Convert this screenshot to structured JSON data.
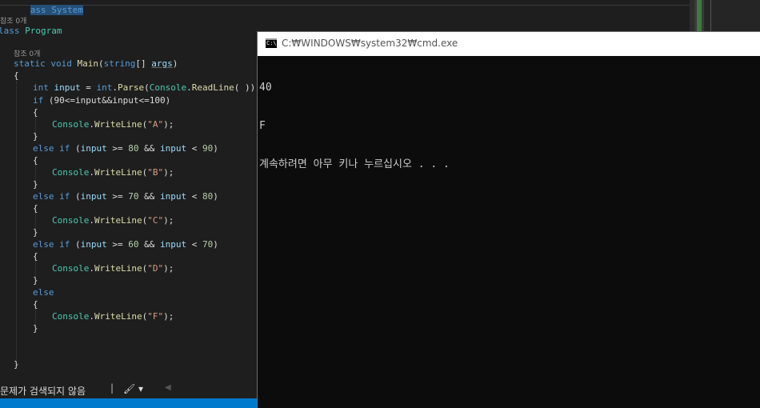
{
  "editor": {
    "header_fragment": "ass System",
    "refs": [
      "참조 0개",
      "참조 0개"
    ],
    "class_decl": {
      "kw": "lass",
      "name": "Program"
    },
    "main_decl": {
      "static": "static",
      "void": "void",
      "name": "Main",
      "paren_open": "(",
      "string": "string",
      "brackets": "[]",
      "args": "args",
      "paren_close": ")"
    },
    "open_brace": "{",
    "close_brace": "}",
    "input_line": {
      "int": "int",
      "var": "input",
      "eq": " = ",
      "int2": "int",
      "dot": ".",
      "parse": "Parse",
      "po": "(",
      "console": "Console",
      "dot2": ".",
      "readline": "ReadLine",
      "end": "( ));"
    },
    "if_line": {
      "kw": "if",
      "rest": " (90<=input&&input<=100)"
    },
    "else_if_1": {
      "else": "else",
      "if": "if",
      "open": " (",
      "var": "input",
      "op1": " >= ",
      "n1": "80",
      "and": " && ",
      "var2": "input",
      "op2": " < ",
      "n2": "90",
      "close": ")"
    },
    "else_if_2": {
      "else": "else",
      "if": "if",
      "open": " (",
      "var": "input",
      "op1": " >= ",
      "n1": "70",
      "and": " && ",
      "var2": "input",
      "op2": " < ",
      "n2": "80",
      "close": ")"
    },
    "else_if_3": {
      "else": "else",
      "if": "if",
      "open": " (",
      "var": "input",
      "op1": " >= ",
      "n1": "60",
      "and": " && ",
      "var2": "input",
      "op2": " < ",
      "n2": "70",
      "close": ")"
    },
    "else_kw": "else",
    "writelines": [
      {
        "console": "Console",
        "dot": ".",
        "fn": "WriteLine",
        "po": "(",
        "str": "\"A\"",
        "pc": ");"
      },
      {
        "console": "Console",
        "dot": ".",
        "fn": "WriteLine",
        "po": "(",
        "str": "\"B\"",
        "pc": ");"
      },
      {
        "console": "Console",
        "dot": ".",
        "fn": "WriteLine",
        "po": "(",
        "str": "\"C\"",
        "pc": ");"
      },
      {
        "console": "Console",
        "dot": ".",
        "fn": "WriteLine",
        "po": "(",
        "str": "\"D\"",
        "pc": ");"
      },
      {
        "console": "Console",
        "dot": ".",
        "fn": "WriteLine",
        "po": "(",
        "str": "\"F\"",
        "pc": ");"
      }
    ]
  },
  "status": {
    "message": "문제가 검색되지 않음",
    "pipe": "|",
    "brush": "🖌 ▾",
    "arrow": "◀"
  },
  "cmd": {
    "title": "C:₩WINDOWS₩system32₩cmd.exe",
    "icon_text": "C:\\",
    "output": [
      "40",
      "F",
      "계속하려면 아무 키나 누르십시오 . . ."
    ]
  },
  "colors": {
    "accent": "#007acc",
    "keyword": "#569cd6",
    "type": "#4ec9b0",
    "method": "#dcdcaa",
    "string": "#d69d85"
  }
}
